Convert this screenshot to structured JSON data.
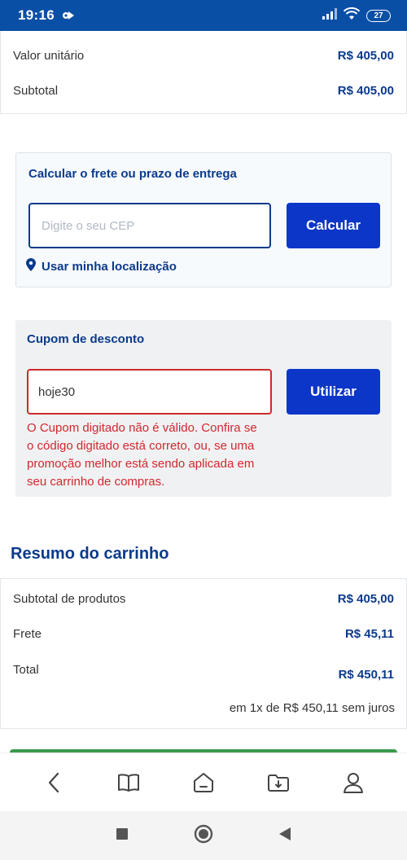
{
  "status_bar": {
    "time": "19:16",
    "battery": "27"
  },
  "top_summary": {
    "unit_price_label": "Valor unitário",
    "unit_price_value": "R$ 405,00",
    "subtotal_label": "Subtotal",
    "subtotal_value": "R$ 405,00"
  },
  "shipping": {
    "title": "Calcular o frete ou prazo de entrega",
    "cep_placeholder": "Digite o seu CEP",
    "calculate_label": "Calcular",
    "use_location_label": "Usar minha localização"
  },
  "coupon": {
    "title": "Cupom de desconto",
    "value": "hoje30",
    "apply_label": "Utilizar",
    "error_message": "O Cupom digitado não é válido. Confira se o código digitado está correto, ou, se uma promoção melhor está sendo aplicada em seu carrinho de compras."
  },
  "cart_summary": {
    "title": "Resumo do carrinho",
    "subtotal_label": "Subtotal de produtos",
    "subtotal_value": "R$ 405,00",
    "shipping_label": "Frete",
    "shipping_value": "R$ 45,11",
    "total_label": "Total",
    "total_value": "R$ 450,11",
    "installments": "em 1x de R$ 450,11 sem juros"
  },
  "colors": {
    "brand_blue": "#0a4fa6",
    "button_blue": "#0b36c8",
    "error_red": "#d2282e",
    "success_green": "#3a9a4d"
  },
  "icons": {
    "browser_bar": [
      "back-icon",
      "bookmarks-icon",
      "home-icon",
      "downloads-icon",
      "profile-icon"
    ],
    "system_nav": [
      "recents-icon",
      "home-circle-icon",
      "back-triangle-icon"
    ]
  }
}
